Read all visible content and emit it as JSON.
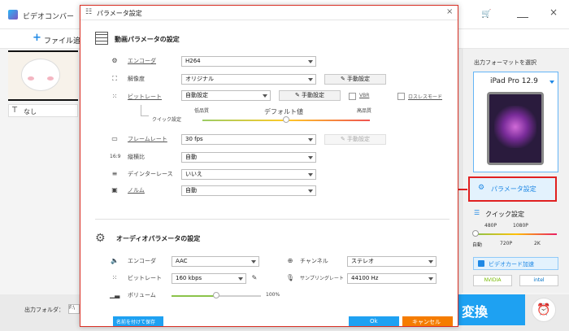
{
  "background": {
    "app_title": "ビデオコンバー",
    "add_file_label": "ファイル追加",
    "subtitle_value": "なし",
    "output_folder_label": "出力フォルダ：",
    "output_path": "F:\\",
    "right_panel": {
      "format_label": "出力フォーマットを選択",
      "device_name": "iPad Pro 12.9",
      "param_button": "パラメータ設定",
      "quick_setting_label": "クイック設定",
      "quality_top": [
        "480P",
        "1080P"
      ],
      "quality_bottom": [
        "自動",
        "720P",
        "2K"
      ],
      "video_card_label": "ビデオカード加速",
      "gpu_labels": [
        "NVIDIA",
        "intel"
      ]
    },
    "convert_button": "変換",
    "accent_color": "#1ea1f2"
  },
  "dialog": {
    "title": "パラメータ設定",
    "video_section_title": "動画パラメータの設定",
    "encoder": {
      "label": "エンコーダ",
      "value": "H264"
    },
    "resolution": {
      "label": "解像度",
      "value": "オリジナル",
      "button": "手動設定"
    },
    "bitrate": {
      "label": "ビットレート",
      "value": "自動設定",
      "button": "手動設定",
      "vbr_label": "VBR",
      "lossless_label": "ロスレスモード"
    },
    "quick_setting": {
      "label": "クイック設定",
      "low": "低品質",
      "default": "デフォルト値",
      "high": "高品質",
      "level_percent": 50
    },
    "framerate": {
      "label": "フレームレート",
      "value": "30 fps",
      "button": "手動設定"
    },
    "aspect": {
      "label": "縦横比",
      "value": "自動"
    },
    "deinterlace": {
      "label": "デインターレース",
      "value": "いいえ"
    },
    "norm": {
      "label": "ノルム",
      "value": "自動"
    },
    "audio_section_title": "オーディオパラメータの設定",
    "audio_encoder": {
      "label": "エンコーダ",
      "value": "AAC"
    },
    "audio_bitrate": {
      "label": "ビットレート",
      "value": "160 kbps"
    },
    "volume": {
      "label": "ボリューム",
      "value": "100%",
      "level_percent": 50
    },
    "channel": {
      "label": "チャンネル",
      "value": "ステレオ"
    },
    "samplerate": {
      "label": "サンプリングレート",
      "value": "44100 Hz"
    },
    "save_as_button": "名前を付けて保存",
    "ok_button": "Ok",
    "cancel_button": "キャンセル"
  },
  "annotation": {
    "arrow_color": "#e02020"
  }
}
